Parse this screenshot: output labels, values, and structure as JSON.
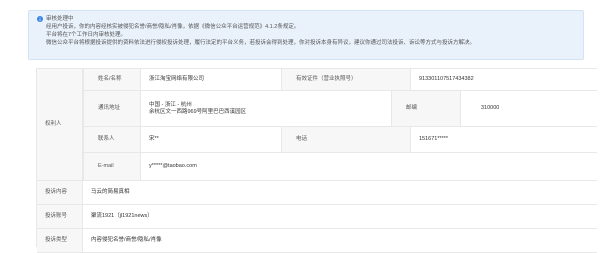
{
  "notice": {
    "title": "审核处理中",
    "line1": "经用户投诉，你的内容经核实被侵犯名誉/商誉/隐私/肖像，依据《微信公众平台运营规范》4.1.2条规定。",
    "line2": "平台将在7个工作日内审核处理。",
    "line3": "微信公众平台将根据投诉提供的资料依法进行侵权投诉处理，履行法定的平台义务，若投诉会得到处理，你对投诉本身有异议，建议你通过司法投诉、诉讼等方式与投诉方解决。"
  },
  "form": {
    "rights_holder_label": "权利人",
    "name_label": "姓名/名称",
    "name_value": "浙江淘宝网络有限公司",
    "id_label": "有效证件（营业执照号）",
    "id_value": "913301107517434382",
    "address_label": "通讯地址",
    "address_line1": "中国 - 浙江 - 杭州",
    "address_line2": "余杭区文一西路969号阿里巴巴西溪园区",
    "postcode_label": "邮编",
    "postcode_value": "310000",
    "contact_label": "联系人",
    "contact_value": "宋**",
    "phone_label": "电话",
    "phone_value": "151671*****",
    "email_label": "E-mail",
    "email_value": "y*****@taobao.com",
    "complaint_content_label": "投诉内容",
    "complaint_content_value": "马云的简易真相",
    "complaint_account_label": "投诉账号",
    "complaint_account_value": "聚流1921（jl1921news）",
    "complaint_type_label": "投诉类型",
    "complaint_type_value": "内容侵犯名誉/商誉/隐私/肖像"
  },
  "colors": {
    "notice_bg": "#e9f1fb",
    "info_icon": "#3a82e6",
    "label_bg": "#f7f7f7",
    "border": "#e8e8e8"
  }
}
